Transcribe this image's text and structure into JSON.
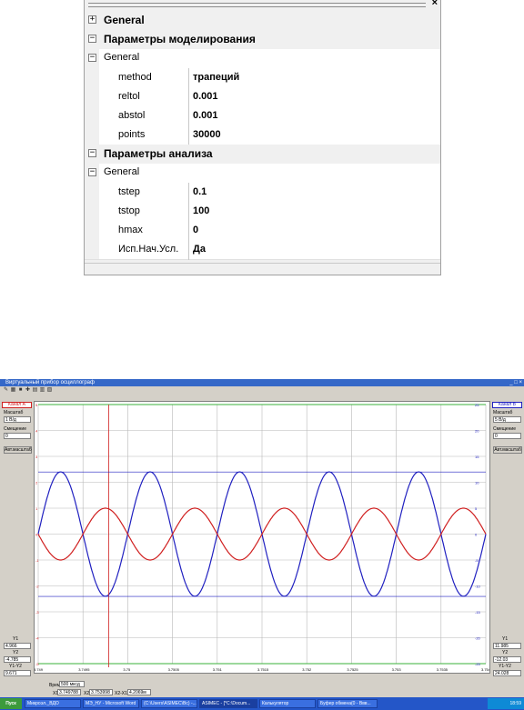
{
  "property_grid": {
    "close_glyph": "×",
    "expander_expanded": "−",
    "expander_collapsed": "+",
    "categories": [
      {
        "title": "General",
        "expanded": false,
        "groups": []
      },
      {
        "title": "Параметры моделирования",
        "expanded": true,
        "groups": [
          {
            "title": "General",
            "properties": [
              {
                "name": "method",
                "value": "трапеций"
              },
              {
                "name": "reltol",
                "value": "0.001"
              },
              {
                "name": "abstol",
                "value": "0.001"
              },
              {
                "name": "points",
                "value": "30000"
              }
            ]
          }
        ]
      },
      {
        "title": "Параметры анализа",
        "expanded": true,
        "groups": [
          {
            "title": "General",
            "properties": [
              {
                "name": "tstep",
                "value": "0.1"
              },
              {
                "name": "tstop",
                "value": "100"
              },
              {
                "name": "hmax",
                "value": "0"
              },
              {
                "name": "Исп.Нач.Усл.",
                "value": "Да"
              }
            ]
          }
        ]
      }
    ]
  },
  "oscilloscope": {
    "title": "Виртуальный прибор осциллограф",
    "window_buttons": "_ □ ×",
    "toolbar_icons": [
      "pen-icon",
      "grid-icon",
      "stop-icon",
      "plus-icon",
      "chart-icon",
      "table-icon",
      "export-icon"
    ],
    "channel_a": {
      "label": "Канал А",
      "color": "#d02020",
      "scale_label": "Масштаб",
      "scale_value": "1 В/д",
      "offset_label": "Смещение",
      "offset_value": "0",
      "auto_button": "Авт.масштаб",
      "y1_label": "Y1",
      "y1_value": "4.966",
      "y2_label": "Y2",
      "y2_value": "-4.785",
      "dy_label": "Y1-Y2",
      "dy_value": "9.671",
      "ticks": [
        "5",
        "4",
        "3",
        "2",
        "1",
        "0",
        "-1",
        "-2",
        "-3",
        "-4",
        "-5"
      ]
    },
    "channel_b": {
      "label": "Канал В",
      "color": "#2020c0",
      "scale_label": "Масштаб",
      "scale_value": "5 В/д",
      "offset_label": "Смещение",
      "offset_value": "0",
      "auto_button": "Авт.масштаб",
      "y1_label": "Y1",
      "y1_value": "11.985",
      "y2_label": "Y2",
      "y2_value": "-12.03",
      "dy_label": "Y1-Y2",
      "dy_value": "24.028",
      "ticks": [
        "25",
        "20",
        "15",
        "10",
        "5",
        "0",
        "-5",
        "-10",
        "-15",
        "-20",
        "-25"
      ]
    },
    "time": {
      "label": "Время (дел.",
      "value": "500 мксд",
      "x1_label": "X1",
      "x1_value": "3.749788",
      "x2_label": "X2",
      "x2_value": "3.753998",
      "dx_label": "X2-X1",
      "dx_value": "4.2069м",
      "ticks": [
        "3.749",
        "3.7495",
        "3.75",
        "3.7505",
        "3.751",
        "3.7515",
        "3.752",
        "3.7525",
        "3.753",
        "3.7535",
        "3.754"
      ]
    },
    "grid": true
  },
  "chart_data": {
    "type": "line",
    "x_range": [
      3.749,
      3.754
    ],
    "series": [
      {
        "name": "Канал А",
        "color": "#d02020",
        "kind": "sine",
        "amplitude": 1.0,
        "cycles_in_window": 5,
        "phase": "inverted vs B"
      },
      {
        "name": "Канал В",
        "color": "#2020c0",
        "kind": "sine",
        "amplitude": 12.0,
        "cycles_in_window": 5
      }
    ],
    "ylim_a": [
      -5,
      5
    ],
    "ylim_b": [
      -25,
      25
    ]
  },
  "taskbar": {
    "start_label": "Пуск",
    "items": [
      "Микроэл._ВДО",
      "МЭ_НУ - Microsoft Word",
      "(C:\\Users\\ASIMEC\\Вс) -...",
      "ASIMEC - [*C:\\Docum...",
      "Калькулятор",
      "Буфер обмена(0 - Ввв..."
    ],
    "clock": "18:59"
  }
}
